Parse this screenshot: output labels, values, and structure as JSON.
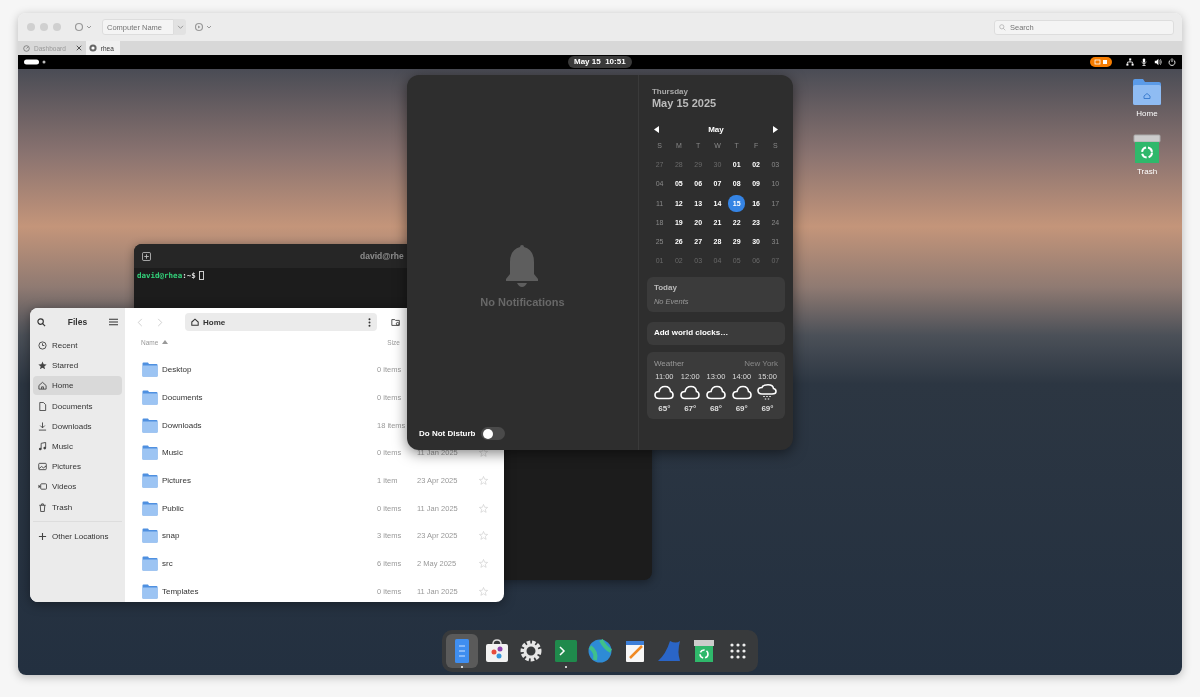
{
  "toolbar": {
    "machine_field": {
      "placeholder": "Computer Name"
    },
    "search": {
      "placeholder": "Search"
    }
  },
  "tabs": [
    {
      "label": "Dashboard",
      "selected": false
    },
    {
      "label": "rhea",
      "selected": true
    }
  ],
  "top_bar": {
    "clock": "May 15  10:51"
  },
  "desktop_icons": [
    {
      "kind": "folder",
      "label": "Home"
    },
    {
      "kind": "trash",
      "label": "Trash"
    }
  ],
  "terminal": {
    "title": "david@rhe",
    "prompt_user": "david@rhea",
    "prompt_path": ":~$"
  },
  "files": {
    "title": "Files",
    "path": "Home",
    "sidebar": [
      {
        "kind": "recent",
        "label": "Recent",
        "selected": false
      },
      {
        "kind": "starred",
        "label": "Starred",
        "selected": false
      },
      {
        "kind": "home",
        "label": "Home",
        "selected": true
      },
      {
        "kind": "documents",
        "label": "Documents",
        "selected": false
      },
      {
        "kind": "downloads",
        "label": "Downloads",
        "selected": false
      },
      {
        "kind": "music",
        "label": "Music",
        "selected": false
      },
      {
        "kind": "pictures",
        "label": "Pictures",
        "selected": false
      },
      {
        "kind": "videos",
        "label": "Videos",
        "selected": false
      },
      {
        "kind": "trash",
        "label": "Trash",
        "selected": false
      }
    ],
    "other_locations": "Other Locations",
    "columns": {
      "name": "Name",
      "size": "Size"
    },
    "rows": [
      {
        "name": "Desktop",
        "size": "0 items"
      },
      {
        "name": "Documents",
        "size": "0 items"
      },
      {
        "name": "Downloads",
        "size": "18 items"
      },
      {
        "name": "Music",
        "size": "0 items",
        "modified": "11 Jan 2025",
        "starred": false
      },
      {
        "name": "Pictures",
        "size": "1 item",
        "modified": "23 Apr 2025",
        "starred": false
      },
      {
        "name": "Public",
        "size": "0 items",
        "modified": "11 Jan 2025",
        "starred": false
      },
      {
        "name": "snap",
        "size": "3 items",
        "modified": "23 Apr 2025",
        "starred": false
      },
      {
        "name": "src",
        "size": "6 items",
        "modified": "2 May 2025",
        "starred": false
      },
      {
        "name": "Templates",
        "size": "0 items",
        "modified": "11 Jan 2025",
        "starred": false
      }
    ]
  },
  "notifications": {
    "empty_text": "No Notifications",
    "do_not_disturb": {
      "label": "Do Not Disturb",
      "on": false
    }
  },
  "calendar": {
    "weekday": "Thursday",
    "date": "May 15 2025",
    "month": "May",
    "weekdays": [
      "S",
      "M",
      "T",
      "W",
      "T",
      "F",
      "S"
    ],
    "weeks": [
      [
        {
          "day": "27",
          "in_month": false,
          "selected": false
        },
        {
          "day": "28",
          "in_month": false,
          "selected": false
        },
        {
          "day": "29",
          "in_month": false,
          "selected": false
        },
        {
          "day": "30",
          "in_month": false,
          "selected": false
        },
        {
          "day": "01",
          "in_month": true,
          "selected": false
        },
        {
          "day": "02",
          "in_month": true,
          "selected": false
        },
        {
          "day": "03",
          "in_month": true,
          "selected": false
        }
      ],
      [
        {
          "day": "04",
          "in_month": true,
          "selected": false
        },
        {
          "day": "05",
          "in_month": true,
          "selected": false
        },
        {
          "day": "06",
          "in_month": true,
          "selected": false
        },
        {
          "day": "07",
          "in_month": true,
          "selected": false
        },
        {
          "day": "08",
          "in_month": true,
          "selected": false
        },
        {
          "day": "09",
          "in_month": true,
          "selected": false
        },
        {
          "day": "10",
          "in_month": true,
          "selected": false
        }
      ],
      [
        {
          "day": "11",
          "in_month": true,
          "selected": false
        },
        {
          "day": "12",
          "in_month": true,
          "selected": false
        },
        {
          "day": "13",
          "in_month": true,
          "selected": false
        },
        {
          "day": "14",
          "in_month": true,
          "selected": false
        },
        {
          "day": "15",
          "in_month": true,
          "selected": true
        },
        {
          "day": "16",
          "in_month": true,
          "selected": false
        },
        {
          "day": "17",
          "in_month": true,
          "selected": false
        }
      ],
      [
        {
          "day": "18",
          "in_month": true,
          "selected": false
        },
        {
          "day": "19",
          "in_month": true,
          "selected": false
        },
        {
          "day": "20",
          "in_month": true,
          "selected": false
        },
        {
          "day": "21",
          "in_month": true,
          "selected": false
        },
        {
          "day": "22",
          "in_month": true,
          "selected": false
        },
        {
          "day": "23",
          "in_month": true,
          "selected": false
        },
        {
          "day": "24",
          "in_month": true,
          "selected": false
        }
      ],
      [
        {
          "day": "25",
          "in_month": true,
          "selected": false
        },
        {
          "day": "26",
          "in_month": true,
          "selected": false
        },
        {
          "day": "27",
          "in_month": true,
          "selected": false
        },
        {
          "day": "28",
          "in_month": true,
          "selected": false
        },
        {
          "day": "29",
          "in_month": true,
          "selected": false
        },
        {
          "day": "30",
          "in_month": true,
          "selected": false
        },
        {
          "day": "31",
          "in_month": true,
          "selected": false
        }
      ],
      [
        {
          "day": "01",
          "in_month": false,
          "selected": false
        },
        {
          "day": "02",
          "in_month": false,
          "selected": false
        },
        {
          "day": "03",
          "in_month": false,
          "selected": false
        },
        {
          "day": "04",
          "in_month": false,
          "selected": false
        },
        {
          "day": "05",
          "in_month": false,
          "selected": false
        },
        {
          "day": "06",
          "in_month": false,
          "selected": false
        },
        {
          "day": "07",
          "in_month": false,
          "selected": false
        }
      ]
    ],
    "today": {
      "title": "Today",
      "events": "No Events"
    },
    "world_clocks": "Add world clocks…",
    "weather": {
      "title": "Weather",
      "location": "New York",
      "hours": [
        {
          "time": "11:00",
          "kind": "cloudy",
          "temp": "65°"
        },
        {
          "time": "12:00",
          "kind": "cloudy",
          "temp": "67°"
        },
        {
          "time": "13:00",
          "kind": "cloudy",
          "temp": "68°"
        },
        {
          "time": "14:00",
          "kind": "cloudy",
          "temp": "69°"
        },
        {
          "time": "15:00",
          "kind": "rain",
          "temp": "69°"
        }
      ]
    }
  },
  "dock": [
    {
      "kind": "files",
      "running": true,
      "focused": true
    },
    {
      "kind": "store",
      "running": false,
      "focused": false
    },
    {
      "kind": "settings",
      "running": false,
      "focused": false
    },
    {
      "kind": "terminal",
      "running": true,
      "focused": false
    },
    {
      "kind": "globe",
      "running": false,
      "focused": false
    },
    {
      "kind": "editor",
      "running": false,
      "focused": false
    },
    {
      "kind": "fin",
      "running": false,
      "focused": false
    },
    {
      "kind": "trash",
      "running": false,
      "focused": false
    },
    {
      "kind": "apps",
      "running": false,
      "focused": false
    }
  ]
}
